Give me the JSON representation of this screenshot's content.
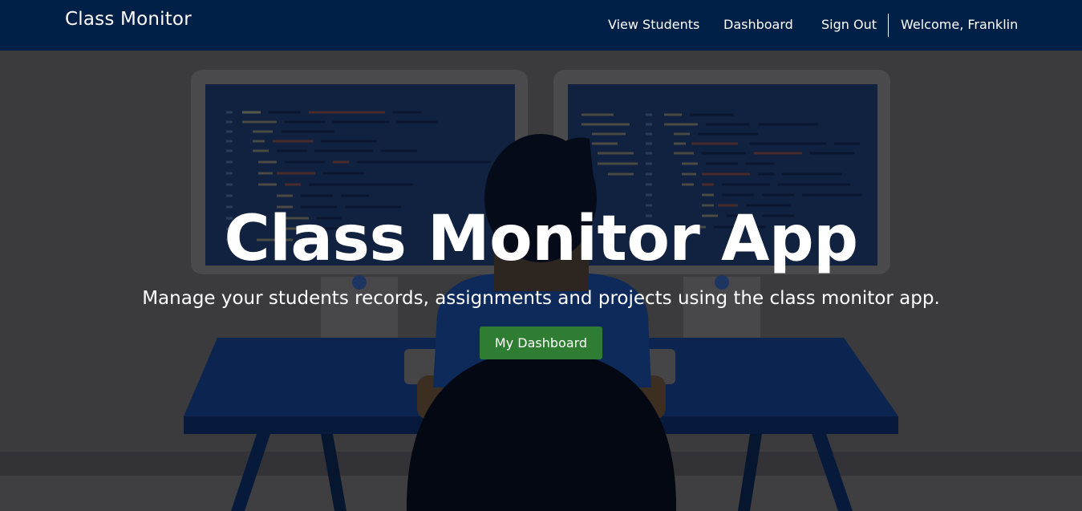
{
  "navbar": {
    "brand": "Class Monitor",
    "links": [
      {
        "label": "View Students"
      },
      {
        "label": "Dashboard"
      },
      {
        "label": "Sign Out"
      }
    ],
    "welcome": "Welcome, Franklin"
  },
  "hero": {
    "title": "Class Monitor App",
    "subtitle": "Manage your students records, assignments and projects using the class monitor app.",
    "cta_label": "My Dashboard"
  },
  "colors": {
    "navbar_bg": "#012047",
    "cta_bg": "#2e7d32"
  }
}
